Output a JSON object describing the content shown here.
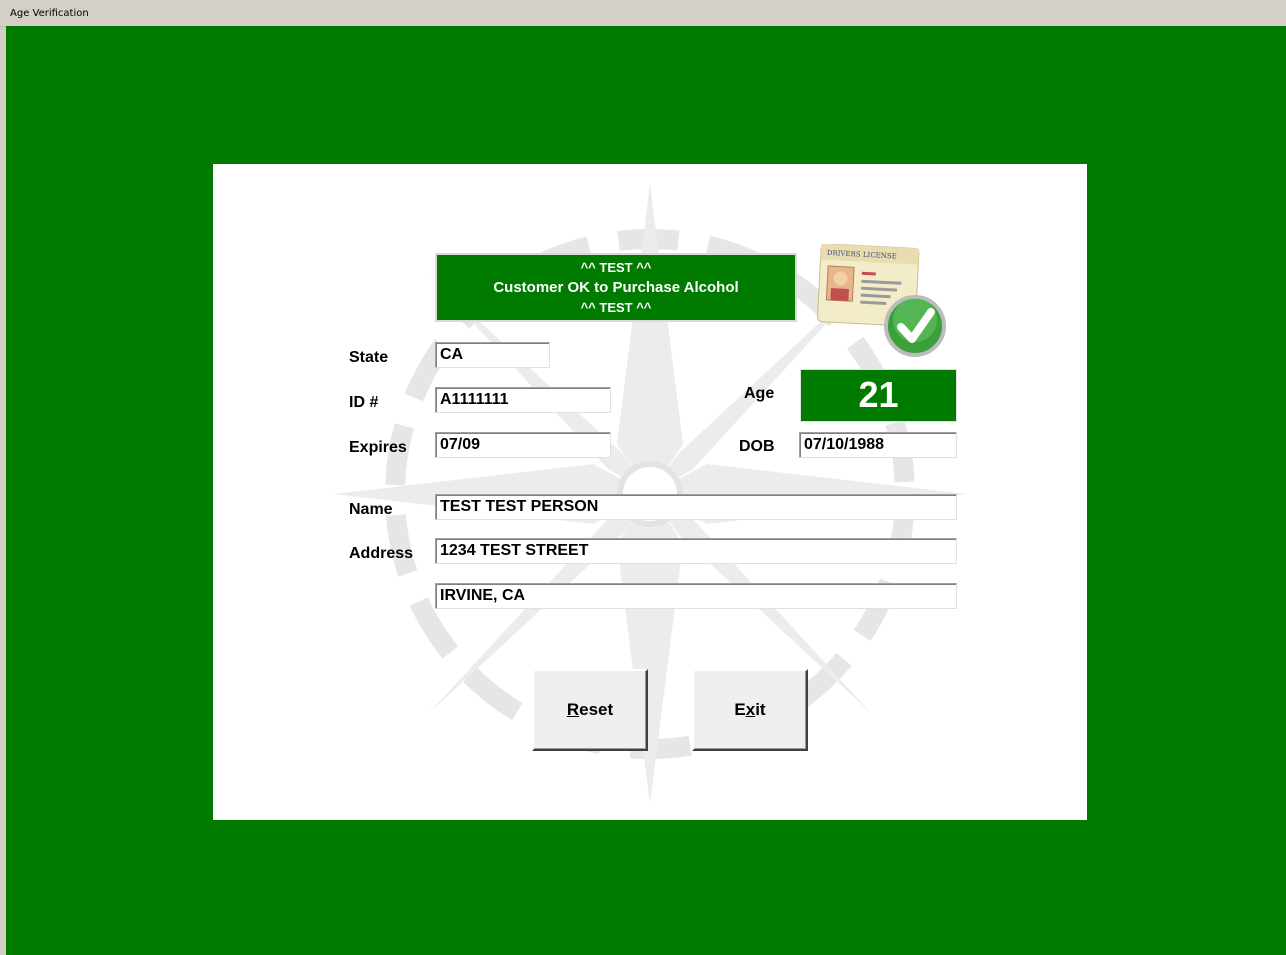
{
  "window": {
    "title": "Age Verification"
  },
  "status": {
    "line1": "^^ TEST ^^",
    "line2": "Customer OK to Purchase Alcohol",
    "line3": "^^ TEST ^^",
    "color": "#007b00"
  },
  "labels": {
    "state": "State",
    "id": "ID #",
    "expires": "Expires",
    "age": "Age",
    "dob": "DOB",
    "name": "Name",
    "address": "Address"
  },
  "fields": {
    "state": "CA",
    "id": "A1111111",
    "expires": "07/09",
    "age": "21",
    "dob": "07/10/1988",
    "name": "TEST TEST PERSON",
    "address1": "1234 TEST STREET",
    "address2": "IRVINE, CA"
  },
  "card_icon": {
    "icon": "drivers-license-check-icon",
    "caption": "DRIVERS LICENSE"
  },
  "buttons": {
    "reset": {
      "pre": "",
      "key": "R",
      "post": "eset"
    },
    "exit": {
      "pre": "E",
      "key": "x",
      "post": "it"
    }
  }
}
